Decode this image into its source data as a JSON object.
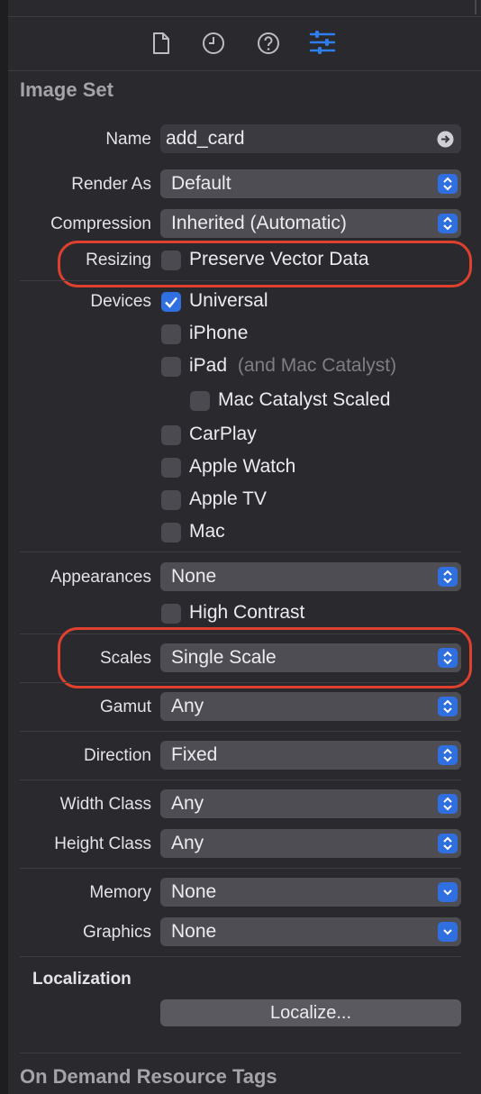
{
  "toolbar": {
    "icons": [
      "file-icon",
      "history-icon",
      "help-icon",
      "attributes-inspector-icon"
    ],
    "active": "attributes-inspector-icon"
  },
  "section_title": "Image Set",
  "name": {
    "label": "Name",
    "value": "add_card"
  },
  "render_as": {
    "label": "Render As",
    "value": "Default"
  },
  "compression": {
    "label": "Compression",
    "value": "Inherited (Automatic)"
  },
  "resizing": {
    "label": "Resizing",
    "checkbox": "Preserve Vector Data",
    "checked": false
  },
  "devices": {
    "label": "Devices",
    "universal": {
      "label": "Universal",
      "checked": true
    },
    "iphone": {
      "label": "iPhone",
      "checked": false
    },
    "ipad": {
      "label": "iPad",
      "note": "(and Mac Catalyst)",
      "checked": false
    },
    "mac_catalyst_scaled": {
      "label": "Mac Catalyst Scaled",
      "checked": false
    },
    "carplay": {
      "label": "CarPlay",
      "checked": false
    },
    "apple_watch": {
      "label": "Apple Watch",
      "checked": false
    },
    "apple_tv": {
      "label": "Apple TV",
      "checked": false
    },
    "mac": {
      "label": "Mac",
      "checked": false
    }
  },
  "appearances": {
    "label": "Appearances",
    "value": "None",
    "high_contrast": {
      "label": "High Contrast",
      "checked": false
    }
  },
  "scales": {
    "label": "Scales",
    "value": "Single Scale"
  },
  "gamut": {
    "label": "Gamut",
    "value": "Any"
  },
  "direction": {
    "label": "Direction",
    "value": "Fixed"
  },
  "width_class": {
    "label": "Width Class",
    "value": "Any"
  },
  "height_class": {
    "label": "Height Class",
    "value": "Any"
  },
  "memory": {
    "label": "Memory",
    "value": "None"
  },
  "graphics": {
    "label": "Graphics",
    "value": "None"
  },
  "localization": {
    "title": "Localization",
    "button": "Localize..."
  },
  "on_demand_title": "On Demand Resource Tags",
  "colors": {
    "accent": "#2f6fe0",
    "highlight_ring": "#e0412e",
    "background": "#2a292e"
  }
}
